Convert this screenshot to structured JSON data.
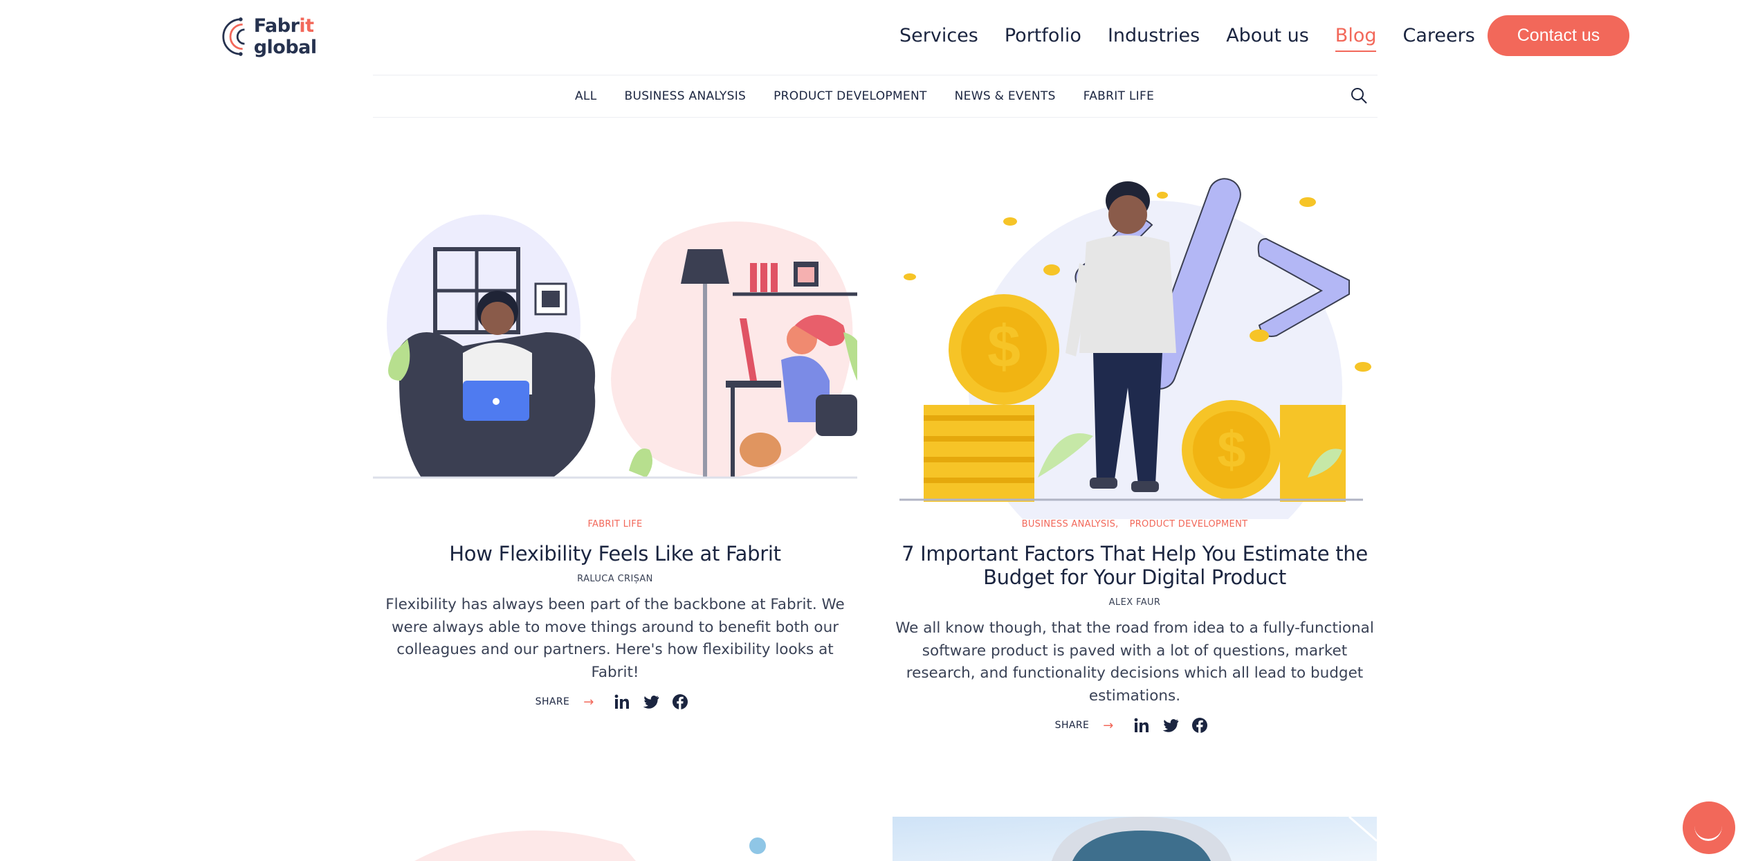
{
  "header": {
    "logo": {
      "prefix": "Fabr",
      "it": "it",
      "suffix": " global"
    },
    "nav": [
      "Services",
      "Portfolio",
      "Industries",
      "About us",
      "Blog",
      "Careers"
    ],
    "active_nav": "Blog",
    "contact_label": "Contact us"
  },
  "categories": [
    "ALL",
    "BUSINESS ANALYSIS",
    "PRODUCT DEVELOPMENT",
    "NEWS & EVENTS",
    "FABRIT LIFE"
  ],
  "posts": [
    {
      "categories": [
        "FABRIT LIFE"
      ],
      "title": "How Flexibility Feels Like at Fabrit",
      "author": "RALUCA CRIȘAN",
      "excerpt": "Flexibility has always been part of the backbone at Fabrit. We were always able to move things around to benefit both our colleagues and our partners. Here's how flexibility looks at Fabrit!",
      "share_label": "SHARE"
    },
    {
      "categories": [
        "BUSINESS ANALYSIS,",
        "PRODUCT DEVELOPMENT"
      ],
      "title": "7 Important Factors That Help You Estimate the Budget for Your Digital Product",
      "author": "ALEX FAUR",
      "excerpt": "We all know though, that the road from idea to a fully-functional software product is paved with a lot of questions, market research, and functionality decisions which all lead to budget estimations.",
      "share_label": "SHARE"
    }
  ],
  "colors": {
    "accent": "#f2685a",
    "text": "#1b2540",
    "muted": "#3a4256"
  }
}
